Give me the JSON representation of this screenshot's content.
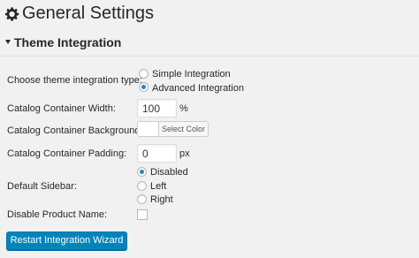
{
  "page": {
    "title": "General Settings"
  },
  "section": {
    "title": "Theme Integration"
  },
  "integration_type": {
    "label": "Choose theme integration type:",
    "options": [
      "Simple Integration",
      "Advanced Integration"
    ],
    "selected": "Advanced Integration"
  },
  "container_width": {
    "label": "Catalog Container Width:",
    "value": "100",
    "unit": "%"
  },
  "container_background": {
    "label": "Catalog Container Background:",
    "button_label": "Select Color"
  },
  "container_padding": {
    "label": "Catalog Container Padding:",
    "value": "0",
    "unit": "px"
  },
  "default_sidebar": {
    "label": "Default Sidebar:",
    "options": [
      "Disabled",
      "Left",
      "Right"
    ],
    "selected": "Disabled"
  },
  "disable_product_name": {
    "label": "Disable Product Name:",
    "checked": false
  },
  "actions": {
    "restart_label": "Restart Integration Wizard"
  },
  "colors": {
    "accent": "#0085ba",
    "radio_dot": "#1e8cbe",
    "background": "#f1f1f1"
  }
}
